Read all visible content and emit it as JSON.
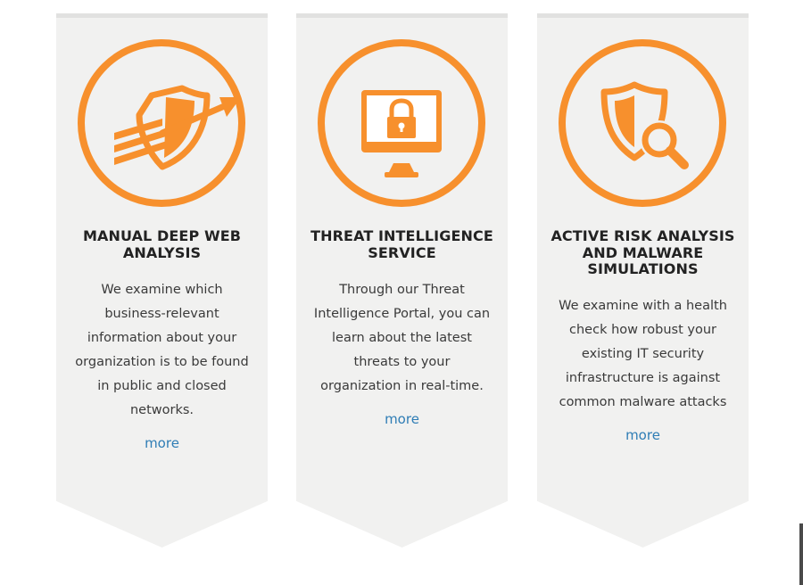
{
  "colors": {
    "accent_orange": "#F7902D",
    "banner_bg": "#F1F1F0",
    "title_text": "#222222",
    "body_text": "#3A3A3A",
    "link_blue": "#2F7DB5"
  },
  "cards": [
    {
      "icon": "shield-arrow-icon",
      "title_lines": [
        "MANUAL DEEP WEB",
        "ANALYSIS"
      ],
      "description_lines": [
        "We examine which",
        "business-relevant",
        "information about your",
        "organization is to be found",
        "in public and closed",
        "networks."
      ],
      "more_label": "more"
    },
    {
      "icon": "monitor-lock-icon",
      "title_lines": [
        "THREAT INTELLIGENCE",
        "SERVICE"
      ],
      "description_lines": [
        "Through our Threat",
        "Intelligence Portal, you can",
        "learn about the latest",
        "threats to your",
        "organization in real-time."
      ],
      "more_label": "more"
    },
    {
      "icon": "shield-magnifier-icon",
      "title_lines": [
        "ACTIVE RISK ANALYSIS",
        "AND MALWARE",
        "SIMULATIONS"
      ],
      "description_lines": [
        "We examine with a health",
        "check how robust your",
        "existing IT security",
        "infrastructure is against",
        "common malware attacks"
      ],
      "more_label": "more"
    }
  ]
}
